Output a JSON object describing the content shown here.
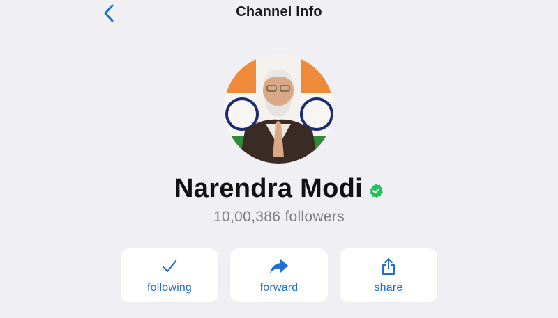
{
  "nav": {
    "title": "Channel Info",
    "back_icon": "chevron-left-icon"
  },
  "profile": {
    "name": "Narendra Modi",
    "verified": true,
    "verified_icon": "verified-check-icon",
    "followers_text": "10,00,386 followers",
    "avatar_icon": "profile-photo"
  },
  "actions": [
    {
      "label": "following",
      "icon": "checkmark-icon"
    },
    {
      "label": "forward",
      "icon": "forward-arrow-icon"
    },
    {
      "label": "share",
      "icon": "share-icon"
    }
  ],
  "colors": {
    "background": "#efeff4",
    "accent": "#1f6fd1",
    "verified": "#25c05a",
    "text_primary": "#111111",
    "text_secondary": "#7b7b80"
  }
}
